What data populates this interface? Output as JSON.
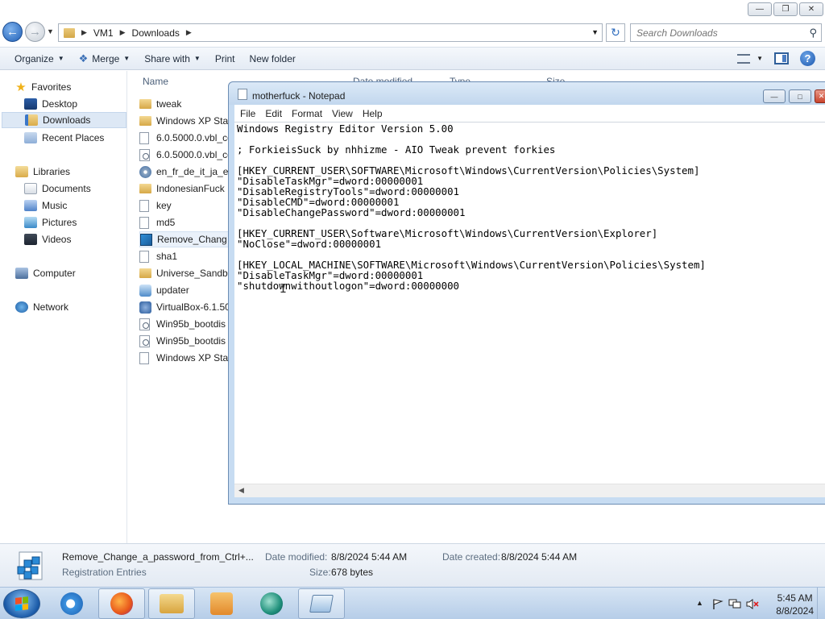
{
  "explorer": {
    "address": {
      "crumbs": [
        "VM1",
        "Downloads"
      ]
    },
    "search_placeholder": "Search Downloads",
    "toolbar": {
      "organize": "Organize",
      "merge": "Merge",
      "share_with": "Share with",
      "print": "Print",
      "new_folder": "New folder"
    },
    "columns": {
      "name": "Name",
      "date_modified": "Date modified",
      "type": "Type",
      "size": "Size"
    },
    "nav": {
      "favorites": "Favorites",
      "desktop": "Desktop",
      "downloads": "Downloads",
      "recent_places": "Recent Places",
      "libraries": "Libraries",
      "documents": "Documents",
      "music": "Music",
      "pictures": "Pictures",
      "videos": "Videos",
      "computer": "Computer",
      "network": "Network"
    },
    "files": [
      {
        "name": "tweak",
        "icon": "folder-icon"
      },
      {
        "name": "Windows XP Sta",
        "icon": "folder-icon"
      },
      {
        "name": "6.0.5000.0.vbl_co",
        "icon": "file-icon"
      },
      {
        "name": "6.0.5000.0.vbl_co",
        "icon": "config-file-icon"
      },
      {
        "name": "en_fr_de_it_ja_es",
        "icon": "disc-image-icon"
      },
      {
        "name": "IndonesianFuck",
        "icon": "folder-icon"
      },
      {
        "name": "key",
        "icon": "file-icon"
      },
      {
        "name": "md5",
        "icon": "file-icon"
      },
      {
        "name": "Remove_Chang",
        "icon": "registry-file-icon"
      },
      {
        "name": "sha1",
        "icon": "file-icon"
      },
      {
        "name": "Universe_Sandb",
        "icon": "folder-icon"
      },
      {
        "name": "updater",
        "icon": "setup-icon"
      },
      {
        "name": "VirtualBox-6.1.50",
        "icon": "virtualbox-icon"
      },
      {
        "name": "Win95b_bootdis",
        "icon": "config-file-icon"
      },
      {
        "name": "Win95b_bootdis",
        "icon": "config-file-icon"
      },
      {
        "name": "Windows XP Sta",
        "icon": "file-icon"
      }
    ],
    "details": {
      "name": "Remove_Change_a_password_from_Ctrl+...",
      "type": "Registration Entries",
      "date_modified_label": "Date modified:",
      "date_modified": "8/8/2024 5:44 AM",
      "date_created_label": "Date created:",
      "date_created": "8/8/2024 5:44 AM",
      "size_label": "Size:",
      "size": "678 bytes"
    }
  },
  "notepad": {
    "title": "motherfuck - Notepad",
    "menu": [
      "File",
      "Edit",
      "Format",
      "View",
      "Help"
    ],
    "content": "Windows Registry Editor Version 5.00\n\n; ForkieisSuck by nhhizme - AIO Tweak prevent forkies\n\n[HKEY_CURRENT_USER\\SOFTWARE\\Microsoft\\Windows\\CurrentVersion\\Policies\\System]\n\"DisableTaskMgr\"=dword:00000001\n\"DisableRegistryTools\"=dword:00000001\n\"DisableCMD\"=dword:00000001\n\"DisableChangePassword\"=dword:00000001\n\n[HKEY_CURRENT_USER\\Software\\Microsoft\\Windows\\CurrentVersion\\Explorer]\n\"NoClose\"=dword:00000001\n\n[HKEY_LOCAL_MACHINE\\SOFTWARE\\Microsoft\\Windows\\CurrentVersion\\Policies\\System]\n\"DisableTaskMgr\"=dword:00000001\n\"shutdownwithoutlogon\"=dword:00000000"
  },
  "taskbar": {
    "apps": [
      "internet-explorer-icon",
      "firefox-icon",
      "windows-explorer-icon",
      "media-player-icon",
      "virtualbox-icon",
      "notepad-icon"
    ],
    "clock": {
      "time": "5:45 AM",
      "date": "8/8/2024"
    }
  }
}
